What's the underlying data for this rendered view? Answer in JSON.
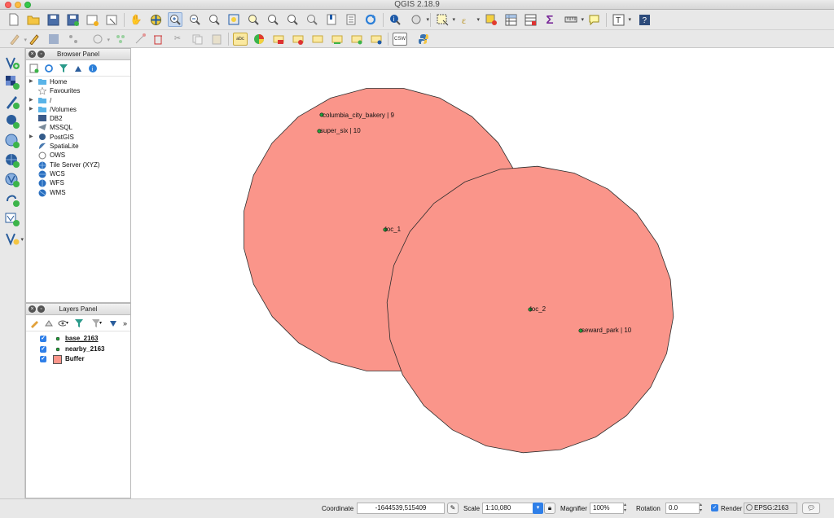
{
  "window": {
    "title": "QGIS 2.18.9"
  },
  "toolbar1": {
    "icons": [
      "new-project-icon",
      "open-project-icon",
      "save-project-icon",
      "save-as-icon",
      "new-print-composer-icon",
      "composer-manager-icon",
      "pan-icon",
      "pan-to-selection-icon",
      "zoom-in-icon",
      "zoom-out-icon",
      "zoom-full-icon",
      "zoom-to-selection-icon",
      "zoom-to-layer-icon",
      "zoom-last-icon",
      "zoom-next-icon",
      "new-bookmark-icon",
      "show-bookmarks-icon",
      "refresh-icon",
      "identify-icon",
      "measure-icon",
      "select-icon",
      "deselect-icon",
      "field-calculator-icon",
      "open-attribute-table-icon",
      "statistics-icon",
      "measure-line-icon",
      "annotation-icon",
      "text-annotation-icon",
      "help-icon"
    ]
  },
  "toolbar2": {
    "icons": [
      "current-edits-icon",
      "toggle-editing-icon",
      "save-edits-icon",
      "add-feature-icon",
      "node-tool-icon",
      "move-feature-icon",
      "delete-selected-icon",
      "cut-features-icon",
      "copy-features-icon",
      "paste-features-icon",
      "label-abc-icon",
      "layer-labeling-icon",
      "pin-labels-icon",
      "highlight-labels-icon",
      "move-label-icon",
      "rotate-label-icon",
      "change-label-icon",
      "label-options-icon",
      "csw-icon",
      "python-console-icon"
    ],
    "csw_label": "CSW",
    "abc_label": "abc"
  },
  "left_toolbar": {
    "icons": [
      "add-vector-layer-icon",
      "add-raster-layer-icon",
      "add-delimited-text-icon",
      "add-postgis-layer-icon",
      "add-spatialite-layer-icon",
      "add-wms-layer-icon",
      "add-wfs-layer-icon",
      "add-wcs-layer-icon",
      "add-virtual-layer-icon",
      "new-shapefile-icon"
    ]
  },
  "browser_panel": {
    "title": "Browser Panel",
    "items": [
      {
        "label": "Home",
        "icon": "folder-icon",
        "expandable": true
      },
      {
        "label": "Favourites",
        "icon": "star-icon",
        "expandable": false
      },
      {
        "label": "/",
        "icon": "folder-icon",
        "expandable": true
      },
      {
        "label": "/Volumes",
        "icon": "folder-icon",
        "expandable": true
      },
      {
        "label": "DB2",
        "icon": "db2-icon",
        "expandable": false
      },
      {
        "label": "MSSQL",
        "icon": "mssql-icon",
        "expandable": false
      },
      {
        "label": "PostGIS",
        "icon": "postgis-icon",
        "expandable": true
      },
      {
        "label": "SpatiaLite",
        "icon": "spatialite-icon",
        "expandable": false
      },
      {
        "label": "OWS",
        "icon": "ows-icon",
        "expandable": false
      },
      {
        "label": "Tile Server (XYZ)",
        "icon": "tile-server-icon",
        "expandable": false
      },
      {
        "label": "WCS",
        "icon": "wcs-icon",
        "expandable": false
      },
      {
        "label": "WFS",
        "icon": "wfs-icon",
        "expandable": false
      },
      {
        "label": "WMS",
        "icon": "wms-icon",
        "expandable": false
      }
    ]
  },
  "layers_panel": {
    "title": "Layers Panel",
    "layers": [
      {
        "name": "base_2163",
        "checked": true,
        "symbol": "point",
        "underline": true
      },
      {
        "name": "nearby_2163",
        "checked": true,
        "symbol": "point",
        "underline": false
      },
      {
        "name": "Buffer",
        "checked": true,
        "symbol": "polygon",
        "underline": false
      }
    ]
  },
  "map": {
    "buffer_fill": "#fa958a",
    "buffer_stroke": "#2d2d2d",
    "point_color": "#22a33a",
    "labels": {
      "columbia": "columbia_city_bakery | 9",
      "super_six": "super_six | 10",
      "loc_1": "loc_1",
      "loc_2": "loc_2",
      "seward": "seward_park | 10"
    }
  },
  "statusbar": {
    "coordinate_label": "Coordinate",
    "coordinate_value": "-1644539,515409",
    "scale_label": "Scale",
    "scale_value": "1:10,080",
    "magnifier_label": "Magnifier",
    "magnifier_value": "100%",
    "rotation_label": "Rotation",
    "rotation_value": "0.0",
    "render_label": "Render",
    "render_checked": true,
    "crs_value": "EPSG:2163"
  },
  "colors": {
    "checkbox_blue": "#2f7fe8",
    "buffer_legend": "#fa958a"
  }
}
